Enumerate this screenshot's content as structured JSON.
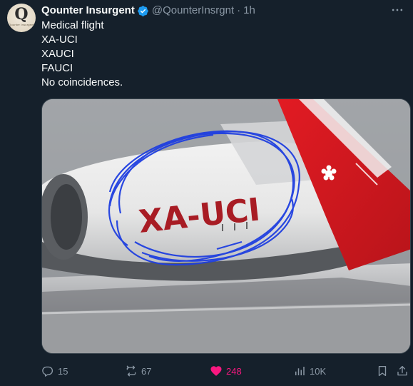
{
  "tweet": {
    "display_name": "Qounter Insurgent",
    "handle": "@QounterInsrgnt",
    "separator": "·",
    "time": "1h",
    "avatar_letter": "Q",
    "avatar_caption": "Qounter Insurgent",
    "text_lines": [
      "Medical flight",
      "XA-UCI",
      "XAUCI",
      "FAUCI",
      "No coincidences."
    ],
    "image": {
      "registration_text": "XA-UCI"
    }
  },
  "actions": {
    "replies": "15",
    "retweets": "67",
    "likes": "248",
    "views": "10K"
  },
  "colors": {
    "background": "#15202b",
    "text_primary": "#f7f9f9",
    "text_secondary": "#8b98a5",
    "verified": "#1d9bf0",
    "like": "#f91880",
    "scribble": "#1f3fe0"
  },
  "icons": {
    "verified": "verified-badge-icon",
    "more": "more-options-icon",
    "reply": "reply-icon",
    "retweet": "retweet-icon",
    "like": "heart-icon",
    "views": "views-icon",
    "bookmark": "bookmark-icon",
    "share": "share-icon"
  }
}
